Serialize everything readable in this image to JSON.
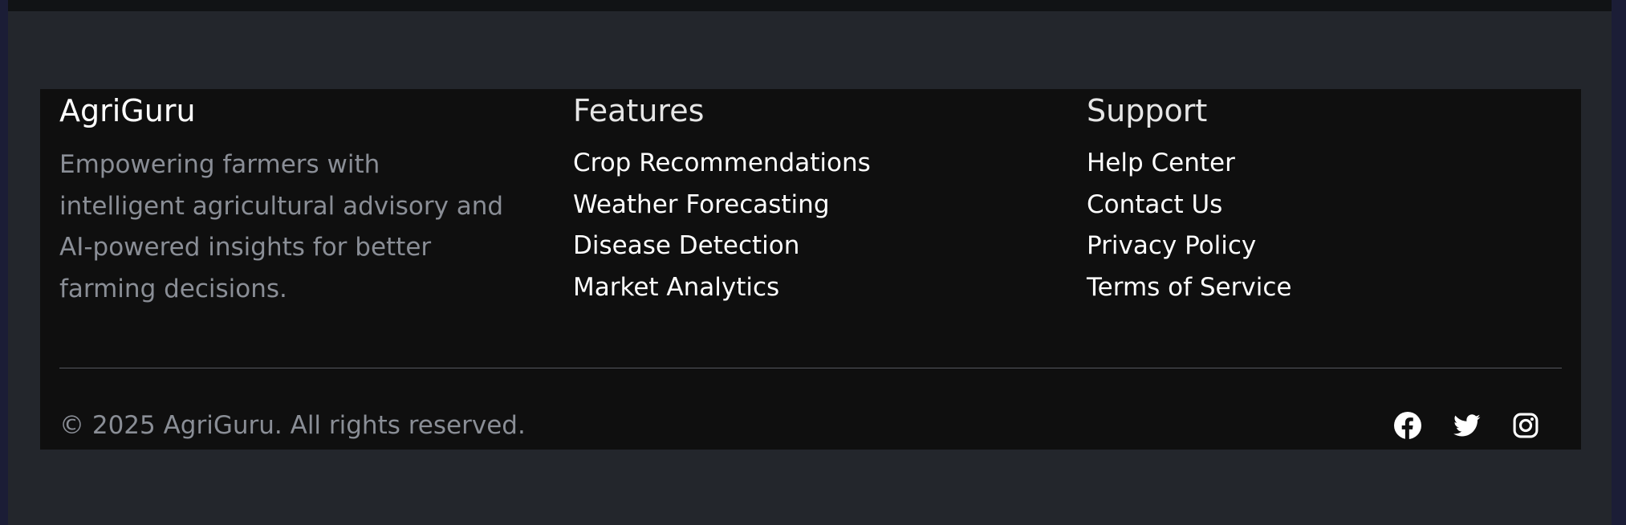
{
  "footer": {
    "brand": {
      "title": "AgriGuru",
      "description": "Empowering farmers with intelligent agricultural advisory and AI-powered insights for better farming decisions."
    },
    "features": {
      "heading": "Features",
      "links": [
        "Crop Recommendations",
        "Weather Forecasting",
        "Disease Detection",
        "Market Analytics"
      ]
    },
    "support": {
      "heading": "Support",
      "links": [
        "Help Center",
        "Contact Us",
        "Privacy Policy",
        "Terms of Service"
      ]
    },
    "copyright": "© 2025 AgriGuru. All rights reserved.",
    "social": {
      "icons": [
        "facebook-icon",
        "twitter-icon",
        "instagram-icon"
      ]
    }
  },
  "colors": {
    "page_background": "#23262c",
    "footer_background": "#0f0f0f",
    "muted_text": "#8a8e96",
    "link_text": "#ffffff",
    "divider": "#55585e"
  }
}
